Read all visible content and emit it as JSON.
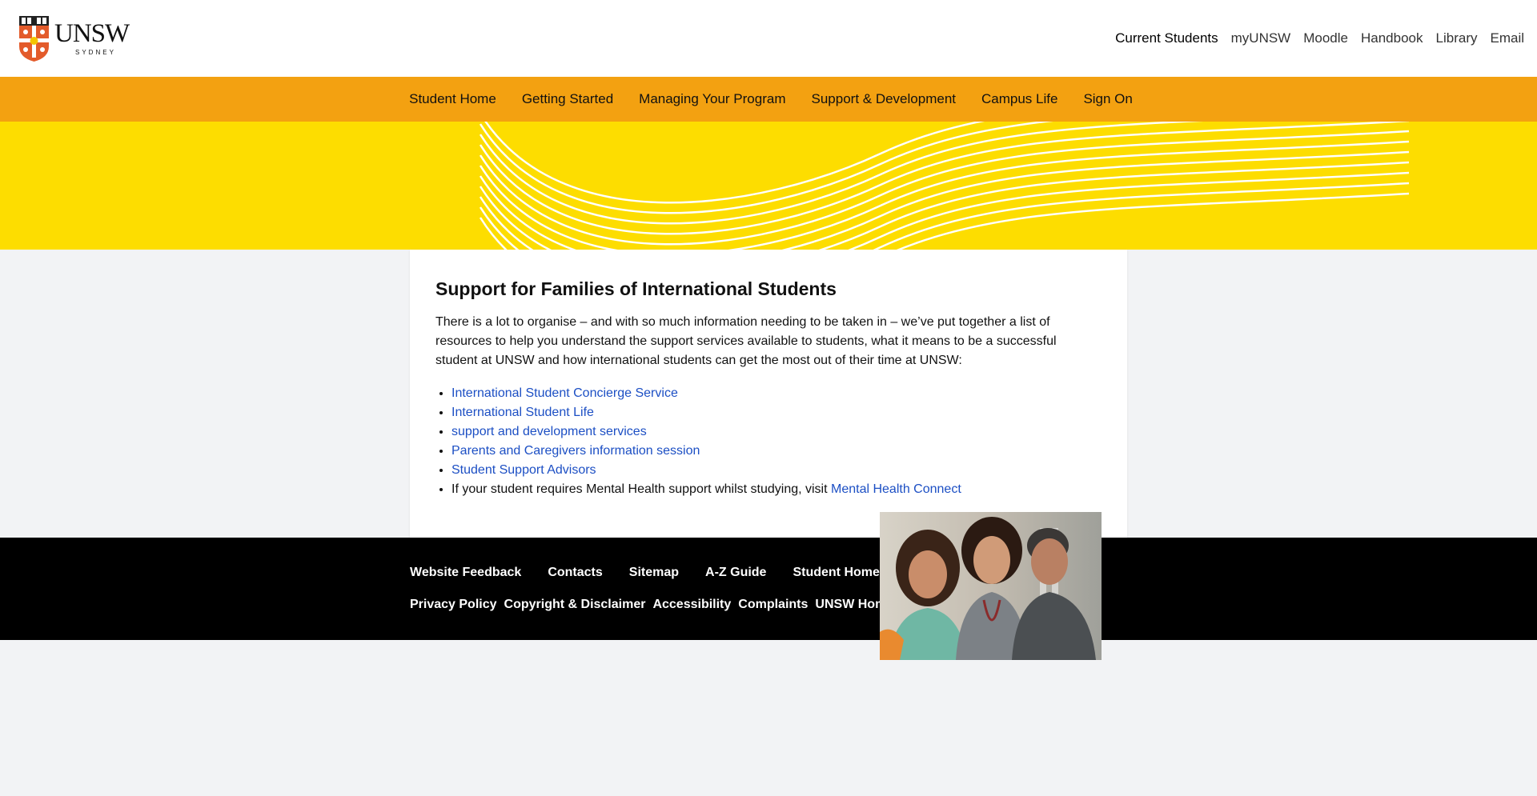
{
  "logo": {
    "wordmark": "UNSW",
    "sub": "SYDNEY"
  },
  "toplinks": [
    "Current Students",
    "myUNSW",
    "Moodle",
    "Handbook",
    "Library",
    "Email"
  ],
  "nav": [
    "Student Home",
    "Getting Started",
    "Managing Your Program",
    "Support & Development",
    "Campus Life",
    "Sign On"
  ],
  "content": {
    "title": "Support for Families of International Students",
    "intro": "There is a lot to organise – and with so much information needing to be taken in – we’ve put together a list of resources to help you understand the support services available to students, what it means to be a successful student at UNSW and how international students can get the most out of their time at UNSW:",
    "links": [
      "International Student Concierge Service",
      "International Student Life",
      "support and development services",
      "Parents and Caregivers information session",
      "Student Support Advisors"
    ],
    "last_item_text": "If your student requires Mental Health support whilst studying, visit ",
    "last_item_link": "Mental Health Connect"
  },
  "footer": {
    "row1": [
      "Website Feedback",
      "Contacts",
      "Sitemap",
      "A-Z Guide",
      "Student Home"
    ],
    "row2": [
      "Privacy Policy",
      "Copyright & Disclaimer",
      "Accessibility",
      "Complaints",
      "UNSW Home"
    ]
  },
  "colors": {
    "nav": "#f3a111",
    "banner": "#fddd00",
    "link": "#1c4fc4",
    "footer": "#000000"
  },
  "icons": {
    "logo": "unsw-crest-icon"
  }
}
